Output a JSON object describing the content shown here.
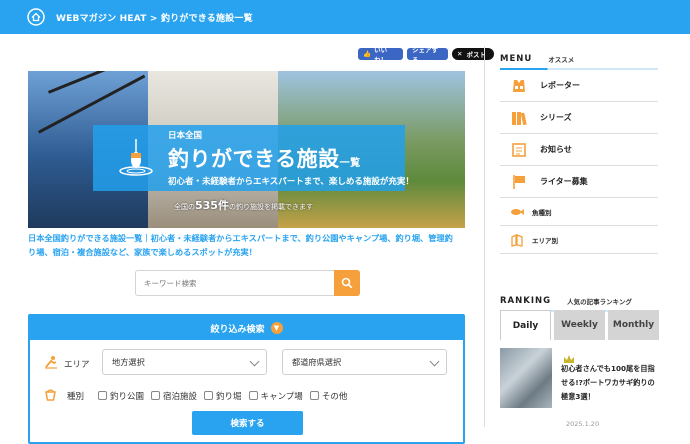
{
  "breadcrumb": {
    "text": "WEBマガジン HEAT > 釣りができる施設一覧"
  },
  "share": {
    "like": "いいね！",
    "share": "シェアする",
    "post": "ポスト"
  },
  "hero": {
    "brand": "日本全国",
    "title": "釣りができる施設",
    "title_suffix": "一覧",
    "subtitle": "初心者・未経験者からエキスパートまで、楽しめる施設が充実！",
    "count_prefix": "全国の",
    "count": "535件",
    "count_suffix": "の釣り施設を掲載できます"
  },
  "intro": {
    "line1": "日本全国釣りができる施設一覧｜初心者・未経験者からエキスパートまで、釣り公園やキャンプ場、釣り堀、管理釣",
    "line2": "り場、宿泊・複合施設など、家族で楽しめるスポットが充実！"
  },
  "search": {
    "placeholder": "キーワード検索"
  },
  "filter": {
    "title": "絞り込み検索",
    "area_label": "エリア",
    "region_select": "地方選択",
    "pref_select": "都道府県選択",
    "type_label": "種別",
    "types": [
      "釣り公園",
      "宿泊施設",
      "釣り堀",
      "キャンプ場",
      "その他"
    ],
    "submit": "検索する"
  },
  "sidebar": {
    "menu_title": "MENU",
    "menu_sub": "オススメ",
    "items": [
      {
        "label": "レポーター",
        "icon": "vest-icon"
      },
      {
        "label": "シリーズ",
        "icon": "books-icon"
      },
      {
        "label": "お知らせ",
        "icon": "notice-icon"
      },
      {
        "label": "ライター募集",
        "icon": "flag-icon"
      }
    ],
    "small_items": [
      {
        "label": "魚種別",
        "icon": "fish-icon"
      },
      {
        "label": "エリア別",
        "icon": "map-icon"
      }
    ],
    "ranking_title": "RANKING",
    "ranking_sub": "人気の記事ランキング",
    "tabs": [
      "Daily",
      "Weekly",
      "Monthly"
    ],
    "rank1_title": "初心者さんでも100尾を目指せる!?ボートワカサギ釣りの極意3選！",
    "rank1_date": "2025.1.20"
  },
  "colors": {
    "accent": "#29a3f0",
    "orange": "#f5a03a"
  }
}
